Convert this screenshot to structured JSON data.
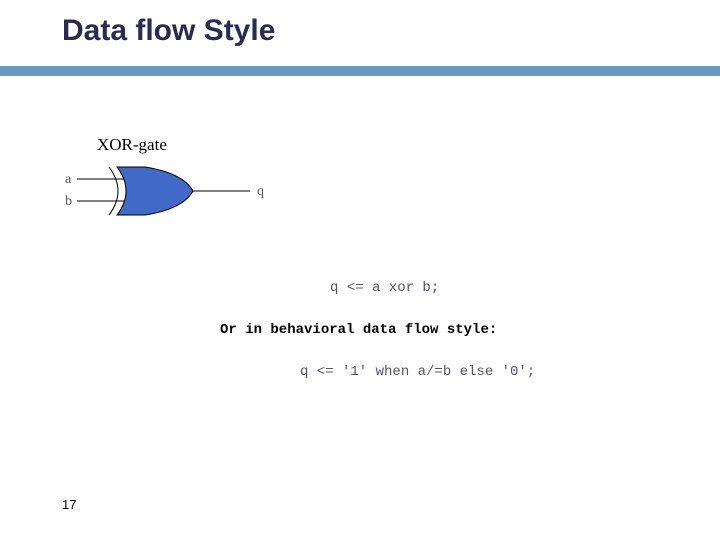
{
  "title": "Data flow Style",
  "page_number": "17",
  "gate": {
    "name": "XOR-gate",
    "input_a": "a",
    "input_b": "b",
    "output": "q"
  },
  "code": {
    "dataflow": "q <= a xor b;",
    "caption": "Or in behavioral data flow style:",
    "behavioral": "q <= '1' when a/=b else '0';"
  }
}
